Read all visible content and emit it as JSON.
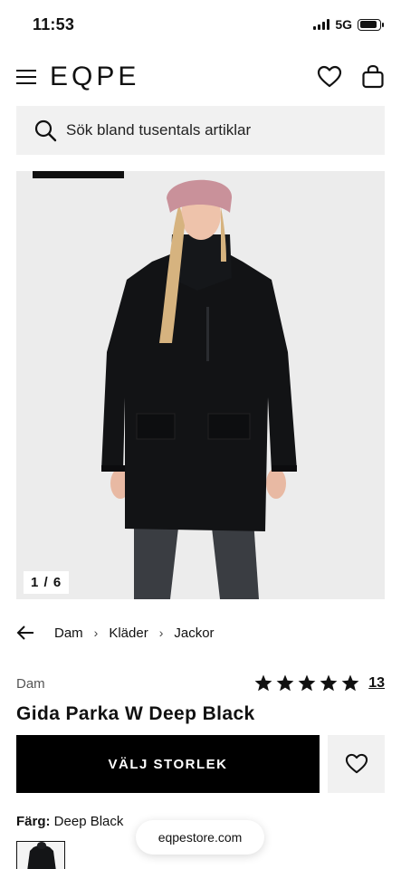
{
  "status_bar": {
    "time": "11:53",
    "network": "5G",
    "battery_level": 0.9
  },
  "header": {
    "logo": "EQPE",
    "icons": [
      "menu-icon",
      "heart-icon",
      "bag-icon"
    ]
  },
  "search": {
    "placeholder": "Sök bland tusentals artiklar",
    "icon": "search-icon"
  },
  "gallery": {
    "counter": "1 / 6",
    "current": 1,
    "total": 6,
    "background": "#ececec"
  },
  "breadcrumb": {
    "items": [
      "Dam",
      "Kläder",
      "Jackor"
    ]
  },
  "product": {
    "brand": "Dam",
    "title": "Gida Parka W Deep Black",
    "rating": 5,
    "review_count": "13"
  },
  "actions": {
    "size_button": "VÄLJ STORLEK"
  },
  "color": {
    "label": "Färg:",
    "value": "Deep Black"
  },
  "browser": {
    "url": "eqpestore.com"
  },
  "colors": {
    "primary": "#000000",
    "surface": "#f1f1f1",
    "text": "#111111"
  }
}
